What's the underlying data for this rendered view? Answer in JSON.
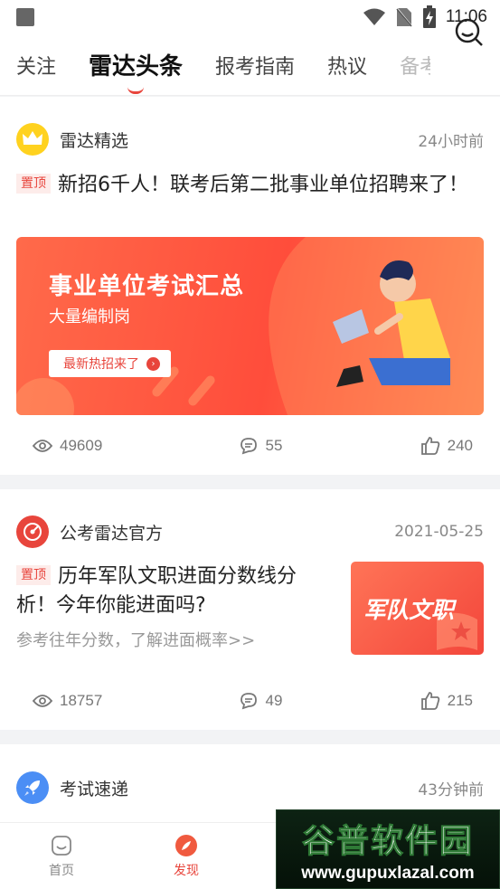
{
  "status_bar": {
    "time": "11:06"
  },
  "tabs": [
    "关注",
    "雷达头条",
    "报考指南",
    "热议",
    "备考"
  ],
  "active_tab": 1,
  "feed": [
    {
      "source": "雷达精选",
      "time": "24小时前",
      "pinned_label": "置顶",
      "title": "新招6千人！联考后第二批事业单位招聘来了！",
      "banner": {
        "title": "事业单位考试汇总",
        "subtitle": "大量编制岗",
        "button": "最新热招来了"
      },
      "views": "49609",
      "comments": "55",
      "likes": "240"
    },
    {
      "source": "公考雷达官方",
      "time": "2021-05-25",
      "pinned_label": "置顶",
      "title": "历年军队文职进面分数线分析！今年你能进面吗?",
      "desc": "参考往年分数，了解进面概率>>",
      "thumb_text": "军队文职",
      "views": "18757",
      "comments": "49",
      "likes": "215"
    },
    {
      "source": "考试速递",
      "time": "43分钟前"
    }
  ],
  "bottom_nav": [
    {
      "label": "首页",
      "icon": "home-icon"
    },
    {
      "label": "发现",
      "icon": "discover-icon"
    }
  ],
  "watermark": {
    "big": "谷普软件园",
    "small": "www.gupuxlazal.com"
  },
  "colors": {
    "accent": "#e8453c",
    "banner": "#ff5640"
  }
}
